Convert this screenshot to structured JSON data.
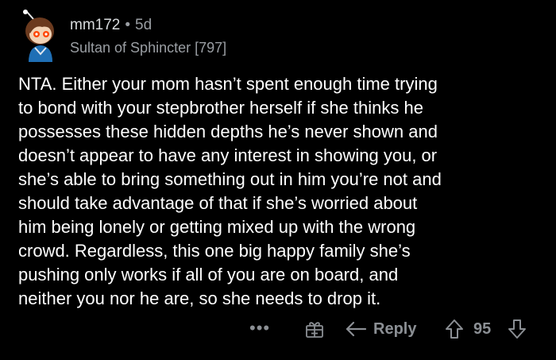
{
  "comment": {
    "username": "mm172",
    "separator": "•",
    "age": "5d",
    "flair": "Sultan of Sphincter [797]",
    "body": "NTA.  Either your mom hasn’t spent enough time trying\nto bond with your stepbrother herself if she thinks he\npossesses these hidden depths he’s never shown and\ndoesn’t appear to have any interest in showing you, or\nshe’s able to bring something out in him you’re not and\nshould take advantage of that if she’s worried about\nhim being lonely or getting mixed up with the wrong\ncrowd.  Regardless, this one big happy family she’s\npushing only works if all of you are on board, and\nneither you nor he are, so she needs to drop it."
  },
  "actions": {
    "more_label": "•••",
    "reply_label": "Reply",
    "score": "95"
  },
  "colors": {
    "background": "#000000",
    "body_text": "#ffffff",
    "meta_text": "#9a9ea3",
    "action_text": "#8b8f94"
  },
  "icons": {
    "avatar": "avatar-icon",
    "more": "more-options-icon",
    "award": "award-gift-icon",
    "reply": "reply-arrow-icon",
    "upvote": "upvote-arrow-icon",
    "downvote": "downvote-arrow-icon"
  }
}
